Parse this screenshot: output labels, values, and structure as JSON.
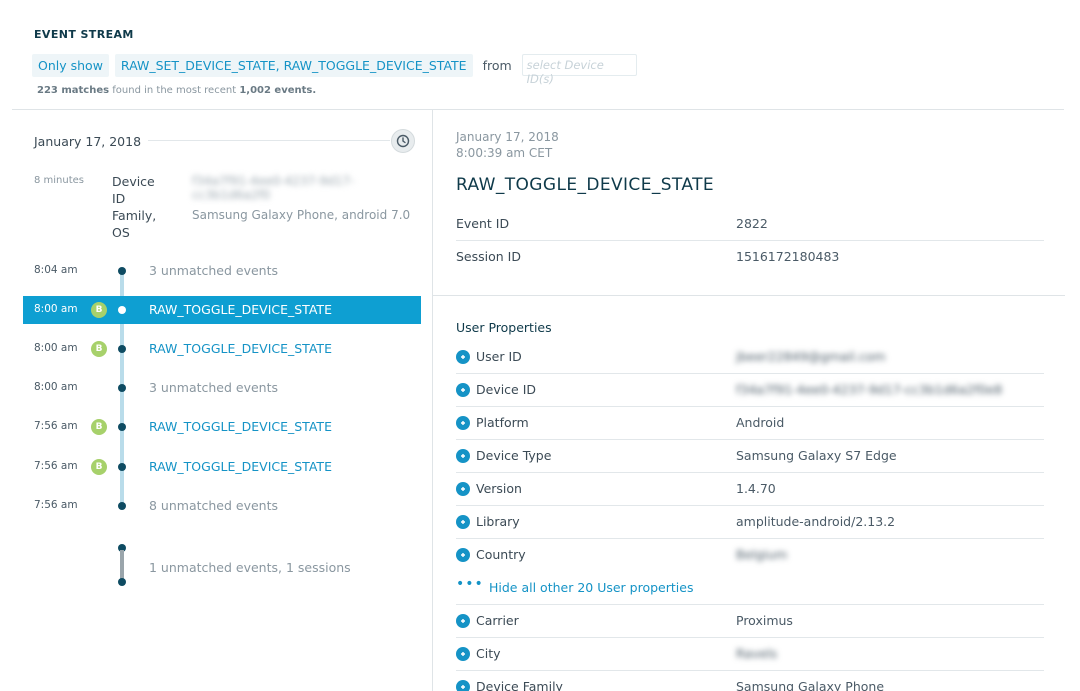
{
  "header": {
    "title": "EVENT STREAM",
    "only_show": "Only show",
    "event_filter": "RAW_SET_DEVICE_STATE, RAW_TOGGLE_DEVICE_STATE",
    "from": "from",
    "device_placeholder": "select Device ID(s)",
    "summary_matches": "223 matches",
    "summary_mid": " found in the most recent ",
    "summary_events": "1,002 events."
  },
  "timeline": {
    "date": "January 17, 2018",
    "clock_icon": "clock-icon",
    "session": {
      "duration": "8 minutes",
      "device_id_label": "Device ID",
      "device_id_value": "f34a7f91-4ee0-4237-9d17-cc3b1d6a2f0",
      "family_os_label": "Family, OS",
      "family_os_value": "Samsung Galaxy Phone, android 7.0"
    },
    "rows": [
      {
        "time": "8:04 am",
        "badge": "",
        "label": "3 unmatched events",
        "kind": "muted"
      },
      {
        "time": "8:00 am",
        "badge": "B",
        "label": "RAW_TOGGLE_DEVICE_STATE",
        "kind": "event",
        "selected": true
      },
      {
        "time": "8:00 am",
        "badge": "B",
        "label": "RAW_TOGGLE_DEVICE_STATE",
        "kind": "event"
      },
      {
        "time": "8:00 am",
        "badge": "",
        "label": "3 unmatched events",
        "kind": "muted"
      },
      {
        "time": "7:56 am",
        "badge": "B",
        "label": "RAW_TOGGLE_DEVICE_STATE",
        "kind": "event"
      },
      {
        "time": "7:56 am",
        "badge": "B",
        "label": "RAW_TOGGLE_DEVICE_STATE",
        "kind": "event"
      },
      {
        "time": "7:56 am",
        "badge": "",
        "label": "8 unmatched events",
        "kind": "muted"
      }
    ],
    "footer_label": "1 unmatched events, 1 sessions"
  },
  "detail": {
    "date": "January 17, 2018",
    "time": "8:00:39 am CET",
    "event_name": "RAW_TOGGLE_DEVICE_STATE",
    "event_id_label": "Event ID",
    "event_id": "2822",
    "session_id_label": "Session ID",
    "session_id": "1516172180483",
    "user_props_title": "User Properties",
    "props": [
      {
        "label": "User ID",
        "value": "jbeer22849@gmail.com",
        "blurred": true
      },
      {
        "label": "Device ID",
        "value": "f34a7f91-4ee0-4237-9d17-cc3b1d6a2f0e8",
        "blurred": true
      },
      {
        "label": "Platform",
        "value": "Android"
      },
      {
        "label": "Device Type",
        "value": "Samsung Galaxy S7 Edge"
      },
      {
        "label": "Version",
        "value": "1.4.70"
      },
      {
        "label": "Library",
        "value": "amplitude-android/2.13.2"
      },
      {
        "label": "Country",
        "value": "Belgium",
        "blurred": true
      }
    ],
    "hide_link": "Hide all other 20 User properties",
    "more_props": [
      {
        "label": "Carrier",
        "value": "Proximus"
      },
      {
        "label": "City",
        "value": "Ravels",
        "blurred": true
      },
      {
        "label": "Device Family",
        "value": "Samsung Galaxy Phone"
      }
    ]
  },
  "colors": {
    "accent": "#1593c6",
    "selected_row": "#0e9fd2",
    "badge": "#a7d16b",
    "heading": "#0f3a4a"
  }
}
